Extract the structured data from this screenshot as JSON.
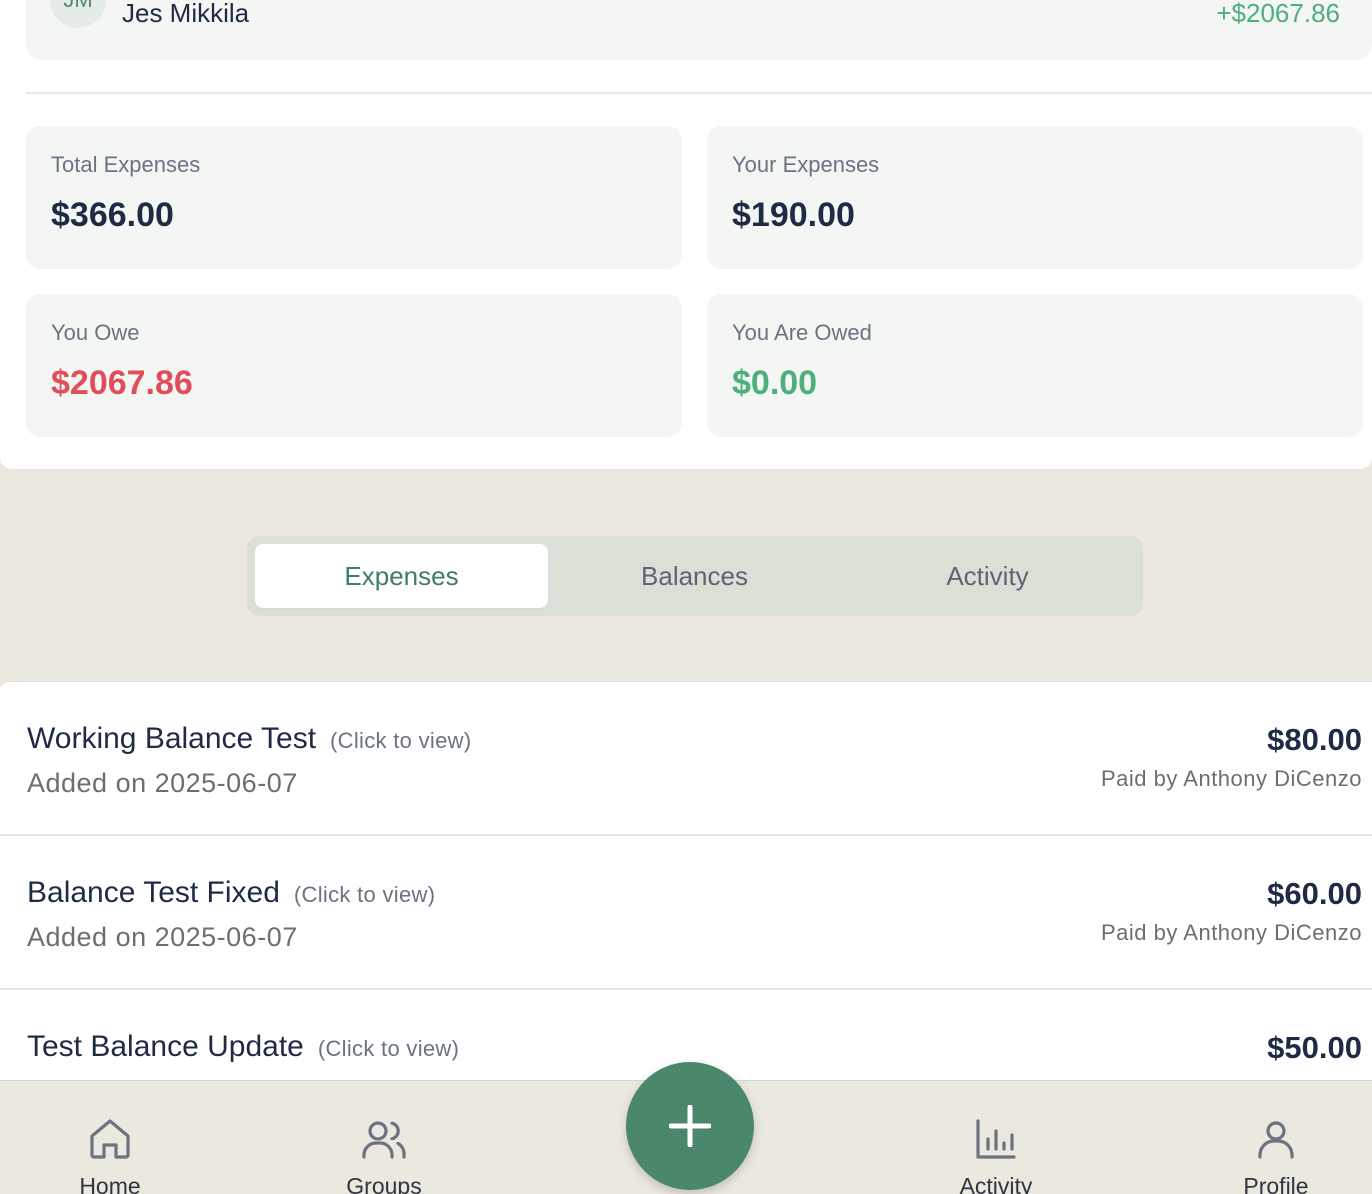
{
  "member": {
    "initials": "JM",
    "name": "Jes Mikkila",
    "balance": "+$2067.86"
  },
  "stats": {
    "total_expenses_label": "Total Expenses",
    "total_expenses_value": "$366.00",
    "your_expenses_label": "Your Expenses",
    "your_expenses_value": "$190.00",
    "you_owe_label": "You Owe",
    "you_owe_value": "$2067.86",
    "you_are_owed_label": "You Are Owed",
    "you_are_owed_value": "$0.00"
  },
  "tabs": [
    {
      "label": "Expenses",
      "active": true
    },
    {
      "label": "Balances",
      "active": false
    },
    {
      "label": "Activity",
      "active": false
    }
  ],
  "expenses": [
    {
      "title": "Working Balance Test",
      "hint": "(Click to view)",
      "date": "Added on 2025-06-07",
      "amount": "$80.00",
      "payer": "Paid by Anthony DiCenzo"
    },
    {
      "title": "Balance Test Fixed",
      "hint": "(Click to view)",
      "date": "Added on 2025-06-07",
      "amount": "$60.00",
      "payer": "Paid by Anthony DiCenzo"
    },
    {
      "title": "Test Balance Update",
      "hint": "(Click to view)",
      "date": "",
      "amount": "$50.00",
      "payer": ""
    }
  ],
  "nav": {
    "home": "Home",
    "groups": "Groups",
    "activity": "Activity",
    "profile": "Profile",
    "home_icon": "home-icon",
    "groups_icon": "users-icon",
    "activity_icon": "bar-chart-icon",
    "profile_icon": "user-icon",
    "add_icon": "plus-icon"
  },
  "colors": {
    "accent": "#4a876b",
    "owe": "#e04e5c",
    "owed": "#4caf7c",
    "background": "#ebe9df"
  }
}
